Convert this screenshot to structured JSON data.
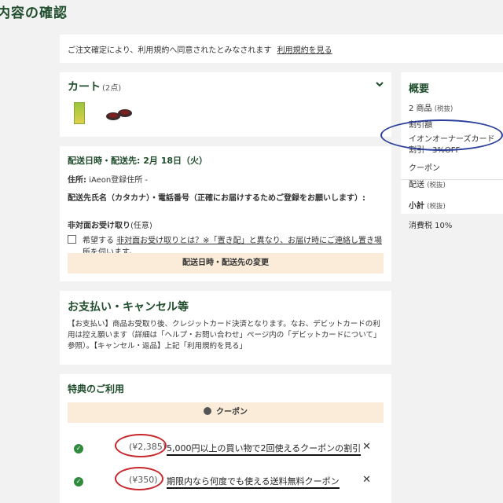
{
  "page_title": "内容の確認",
  "notice": {
    "text": "ご注文確定により、利用規約へ同意されたとみなされます",
    "link": "利用規約を見る"
  },
  "cart": {
    "title": "カート",
    "count": "(2点)"
  },
  "delivery": {
    "date_line": "配送日時・配送先: 2月 18日（火）",
    "address_label": "住所:",
    "address_value": "iAeon登録住所 -",
    "name_line": "配送先氏名（カタカナ）・電話番号（正確にお届けするためご登録をお願いします）:",
    "nonface_label": "非対面お受け取り",
    "nonface_optional": "(任意)",
    "checkbox_pre": "希望する",
    "checkbox_link": "非対面お受け取りとは？※「置き配」と異なり、お届け時にご連絡し置き場所を伺います。",
    "change_button": "配送日時・配送先の変更"
  },
  "payment": {
    "title": "お支払い・キャンセル等",
    "body": "【お支払い】商品お受取り後、クレジットカード決済となります。なお、デビットカードの利用は控え願います（詳細は「ヘルプ・お問い合わせ」ページ内の「デビットカードについて」参照）。【キャンセル・返品】上記「利用規約を見る」"
  },
  "benefits": {
    "title": "特典のご利用",
    "coupon_bar": "クーポン",
    "coupons": [
      {
        "price": "(¥2,385)",
        "desc": "5,000円以上の買い物で2回使えるクーポンの割引"
      },
      {
        "price": "(¥350)",
        "desc": "期限内なら何度でも使える送料無料クーポン"
      }
    ]
  },
  "summary": {
    "title": "概要",
    "items": "2 商品",
    "items_tax": "(税抜)",
    "discount": "割引額",
    "aeon_card": "イオンオーナーズカード割引　3%OFF",
    "coupon": "クーポン",
    "shipping": "配送",
    "shipping_tax": "(税抜)",
    "subtotal": "小計",
    "subtotal_tax": "(税抜)",
    "tax": "消費税 10%"
  },
  "colors": {
    "brand_green": "#1f4d2c",
    "highlight_bar": "#fbecd9",
    "annotation_red": "#c7262b",
    "annotation_blue": "#2a3d9a"
  }
}
